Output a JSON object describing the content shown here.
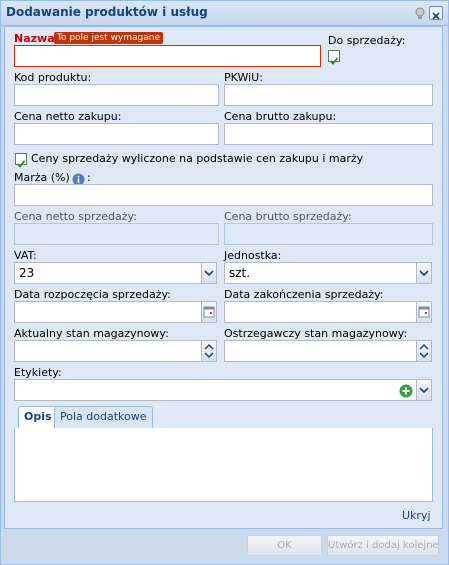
{
  "window": {
    "title": "Dodawanie produktów i usług"
  },
  "form": {
    "name": {
      "label": "Nazwa:",
      "error": "To pole jest wymagane",
      "value": ""
    },
    "for_sale": {
      "label": "Do sprzedaży:",
      "checked": true
    },
    "product_code": {
      "label": "Kod produktu:",
      "value": ""
    },
    "pkwiu": {
      "label": "PKWiU:",
      "value": ""
    },
    "net_purchase": {
      "label": "Cena netto zakupu:",
      "value": ""
    },
    "gross_purchase": {
      "label": "Cena brutto zakupu:",
      "value": ""
    },
    "auto_price": {
      "label": "Ceny sprzedaży wyliczone na podstawie cen zakupu i marży",
      "checked": true
    },
    "margin": {
      "label": "Marża (%)",
      "suffix": ":",
      "value": ""
    },
    "net_sale": {
      "label": "Cena netto sprzedaży:",
      "value": ""
    },
    "gross_sale": {
      "label": "Cena brutto sprzedaży:",
      "value": ""
    },
    "vat": {
      "label": "VAT:",
      "value": "23"
    },
    "unit": {
      "label": "Jednostka:",
      "value": "szt."
    },
    "sale_start": {
      "label": "Data rozpoczęcia sprzedaży:",
      "value": ""
    },
    "sale_end": {
      "label": "Data zakończenia sprzedaży:",
      "value": ""
    },
    "stock": {
      "label": "Aktualny stan magazynowy:",
      "value": ""
    },
    "warning_stock": {
      "label": "Ostrzegawczy stan magazynowy:",
      "value": ""
    },
    "tags": {
      "label": "Etykiety:",
      "value": ""
    }
  },
  "tabs": [
    {
      "label": "Opis",
      "active": true
    },
    {
      "label": "Pola dodatkowe",
      "active": false
    }
  ],
  "hide_link": "Ukryj",
  "buttons": {
    "ok": "OK",
    "create_add_next": "Utwórz i dodaj kolejne"
  },
  "colors": {
    "accent": "#15428b",
    "error": "#c23500",
    "add_icon": "#3c9e3c"
  },
  "icons": [
    "help-icon",
    "close-icon",
    "info-icon",
    "chevron-down-icon",
    "calendar-icon",
    "spinner-icon",
    "add-icon",
    "check-icon"
  ]
}
